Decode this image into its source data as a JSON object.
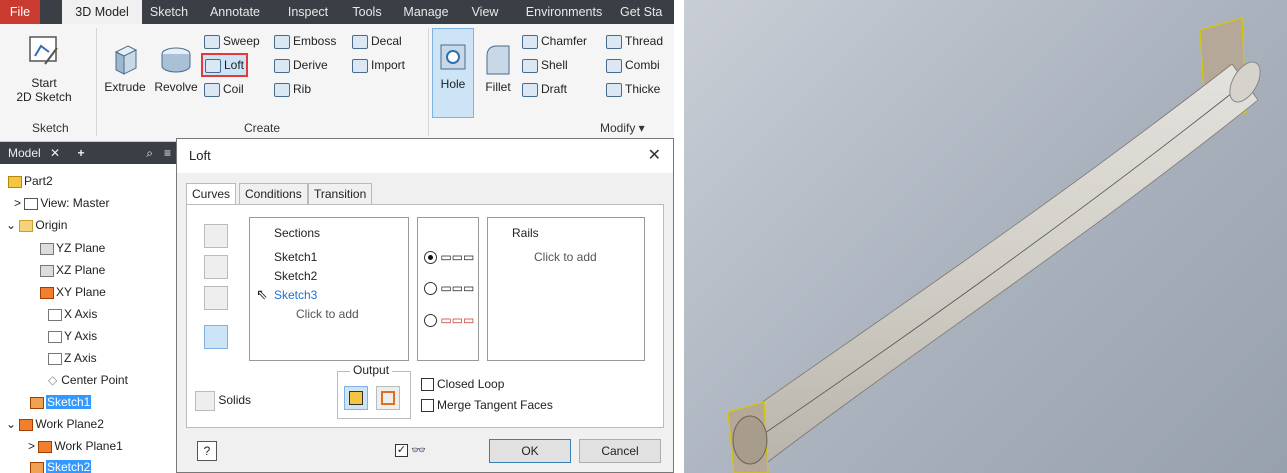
{
  "ribbon_tabs": [
    "File",
    "3D Model",
    "Sketch",
    "Annotate",
    "Inspect",
    "Tools",
    "Manage",
    "View",
    "Environments",
    "Get Sta"
  ],
  "ribbon": {
    "sketch_group": {
      "start_sketch": "Start\n2D Sketch",
      "label": "Sketch"
    },
    "create_group": {
      "extrude": "Extrude",
      "revolve": "Revolve",
      "sweep": "Sweep",
      "loft": "Loft",
      "coil": "Coil",
      "emboss": "Emboss",
      "derive": "Derive",
      "rib": "Rib",
      "decal": "Decal",
      "import": "Import",
      "label": "Create"
    },
    "modify_group": {
      "hole": "Hole",
      "fillet": "Fillet",
      "chamfer": "Chamfer",
      "shell": "Shell",
      "draft": "Draft",
      "thread": "Thread",
      "combine": "Combi",
      "thicken": "Thicke",
      "label": "Modify ▾"
    }
  },
  "browser": {
    "header": "Model",
    "items": [
      {
        "label": "Part2",
        "icon": "part-icon"
      },
      {
        "label": "View: Master",
        "icon": "view-icon"
      },
      {
        "label": "Origin",
        "icon": "folder-icon"
      },
      {
        "label": "YZ Plane",
        "icon": "plane-icon"
      },
      {
        "label": "XZ Plane",
        "icon": "plane-icon"
      },
      {
        "label": "XY Plane",
        "icon": "plane-icon"
      },
      {
        "label": "X Axis",
        "icon": "axis-icon"
      },
      {
        "label": "Y Axis",
        "icon": "axis-icon"
      },
      {
        "label": "Z Axis",
        "icon": "axis-icon"
      },
      {
        "label": "Center Point",
        "icon": "point-icon"
      },
      {
        "label": "Sketch1",
        "icon": "sketch-icon"
      },
      {
        "label": "Work Plane2",
        "icon": "workplane-icon"
      },
      {
        "label": "Work Plane1",
        "icon": "workplane-icon"
      },
      {
        "label": "Sketch2",
        "icon": "sketch-icon"
      }
    ]
  },
  "dialog": {
    "title": "Loft",
    "close": "✕",
    "tabs": [
      "Curves",
      "Conditions",
      "Transition"
    ],
    "sections_header": "Sections",
    "sections": [
      "Sketch1",
      "Sketch2",
      "Sketch3"
    ],
    "click_to_add": "Click to add",
    "rails_header": "Rails",
    "rails_click_to_add": "Click to add",
    "output_label": "Output",
    "solids_label": "Solids",
    "closed_loop": "Closed Loop",
    "merge_tangent": "Merge Tangent Faces",
    "ok": "OK",
    "cancel": "Cancel",
    "help": "?"
  },
  "colors": {
    "file_tab": "#c83b2e",
    "highlight": "#e23b3b",
    "selection": "#3399ff",
    "link_blue": "#1e6fd9"
  }
}
